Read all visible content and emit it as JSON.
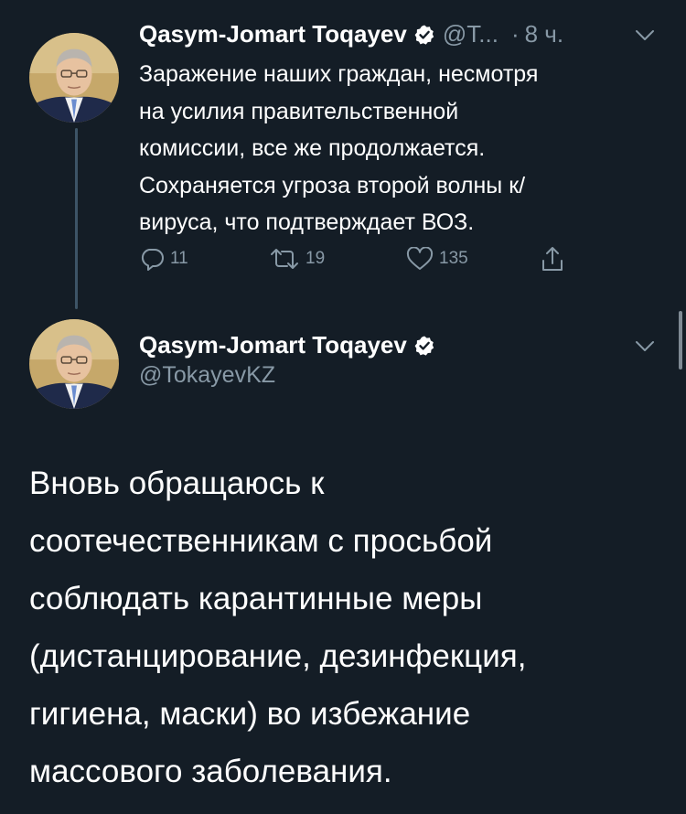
{
  "tweet1": {
    "author_name": "Qasym-Jomart Toqayev",
    "handle_truncated": "@T...",
    "time_separator": "·",
    "time_ago": "8 ч.",
    "text": "Заражение наших граждан, несмотря\nна усилия правительственной\nкомиссии, все же продолжается.\nСохраняется угроза второй волны к/\nвируса, что подтверждает ВОЗ.",
    "reply_count": "11",
    "retweet_count": "19",
    "like_count": "135"
  },
  "tweet2": {
    "author_name": "Qasym-Jomart Toqayev",
    "handle": "@TokayevKZ",
    "text": "Вновь обращаюсь к\nсоотечественникам с просьбой\nсоблюдать карантинные меры\n(дистанцирование, дезинфекция,\nгигиена, маски) во избежание\nмассового заболевания."
  },
  "icons": {
    "verified": "verified-badge-icon",
    "chevron": "chevron-down-icon",
    "reply": "reply-icon",
    "retweet": "retweet-icon",
    "like": "heart-icon",
    "share": "share-icon"
  },
  "colors": {
    "background": "#141d26",
    "text": "#ffffff",
    "muted": "#8899a6",
    "thread_line": "#3d5466"
  }
}
